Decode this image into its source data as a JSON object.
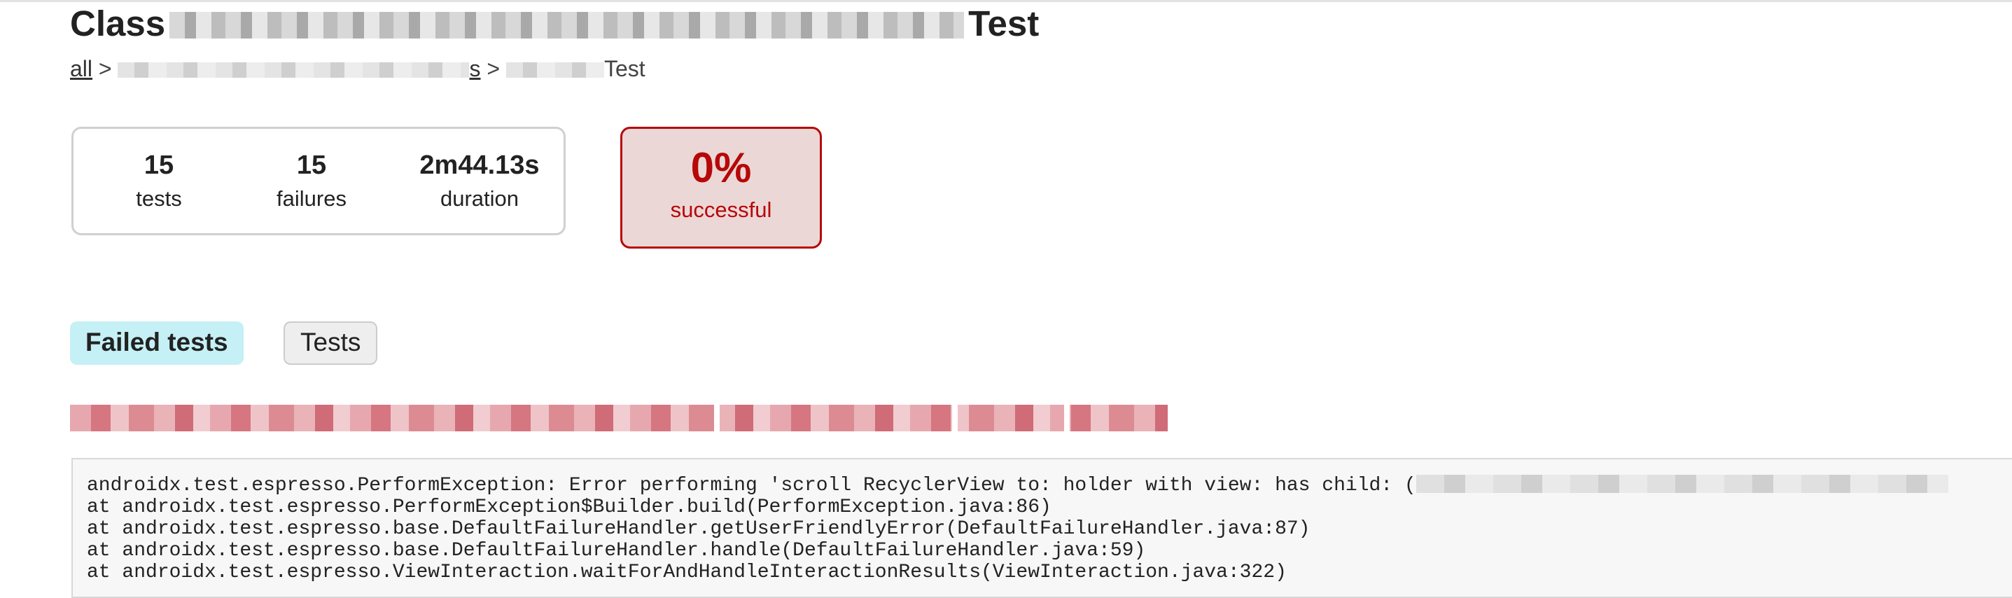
{
  "header": {
    "title_prefix": "Class",
    "title_suffix": "Test"
  },
  "breadcrumb": {
    "root_link": "all",
    "sep1": ">",
    "package_link_tail": "s",
    "sep2": ">",
    "class_tail": "Test"
  },
  "summary": {
    "tests": {
      "value": "15",
      "label": "tests"
    },
    "failures": {
      "value": "15",
      "label": "failures"
    },
    "duration": {
      "value": "2m44.13s",
      "label": "duration"
    },
    "success_rate": {
      "value": "0%",
      "label": "successful"
    }
  },
  "tabs": [
    {
      "label": "Failed tests",
      "active": true
    },
    {
      "label": "Tests",
      "active": false
    }
  ],
  "stacktrace": {
    "lines": [
      "androidx.test.espresso.PerformException: Error performing 'scroll RecyclerView to: holder with view: has child: (",
      "at androidx.test.espresso.PerformException$Builder.build(PerformException.java:86)",
      "at androidx.test.espresso.base.DefaultFailureHandler.getUserFriendlyError(DefaultFailureHandler.java:87)",
      "at androidx.test.espresso.base.DefaultFailureHandler.handle(DefaultFailureHandler.java:59)",
      "at androidx.test.espresso.ViewInteraction.waitForAndHandleInteractionResults(ViewInteraction.java:322)"
    ]
  },
  "colors": {
    "failure_red": "#b60808",
    "success_box_bg": "#ecd7d7",
    "active_tab_bg": "#c5f0f5"
  }
}
